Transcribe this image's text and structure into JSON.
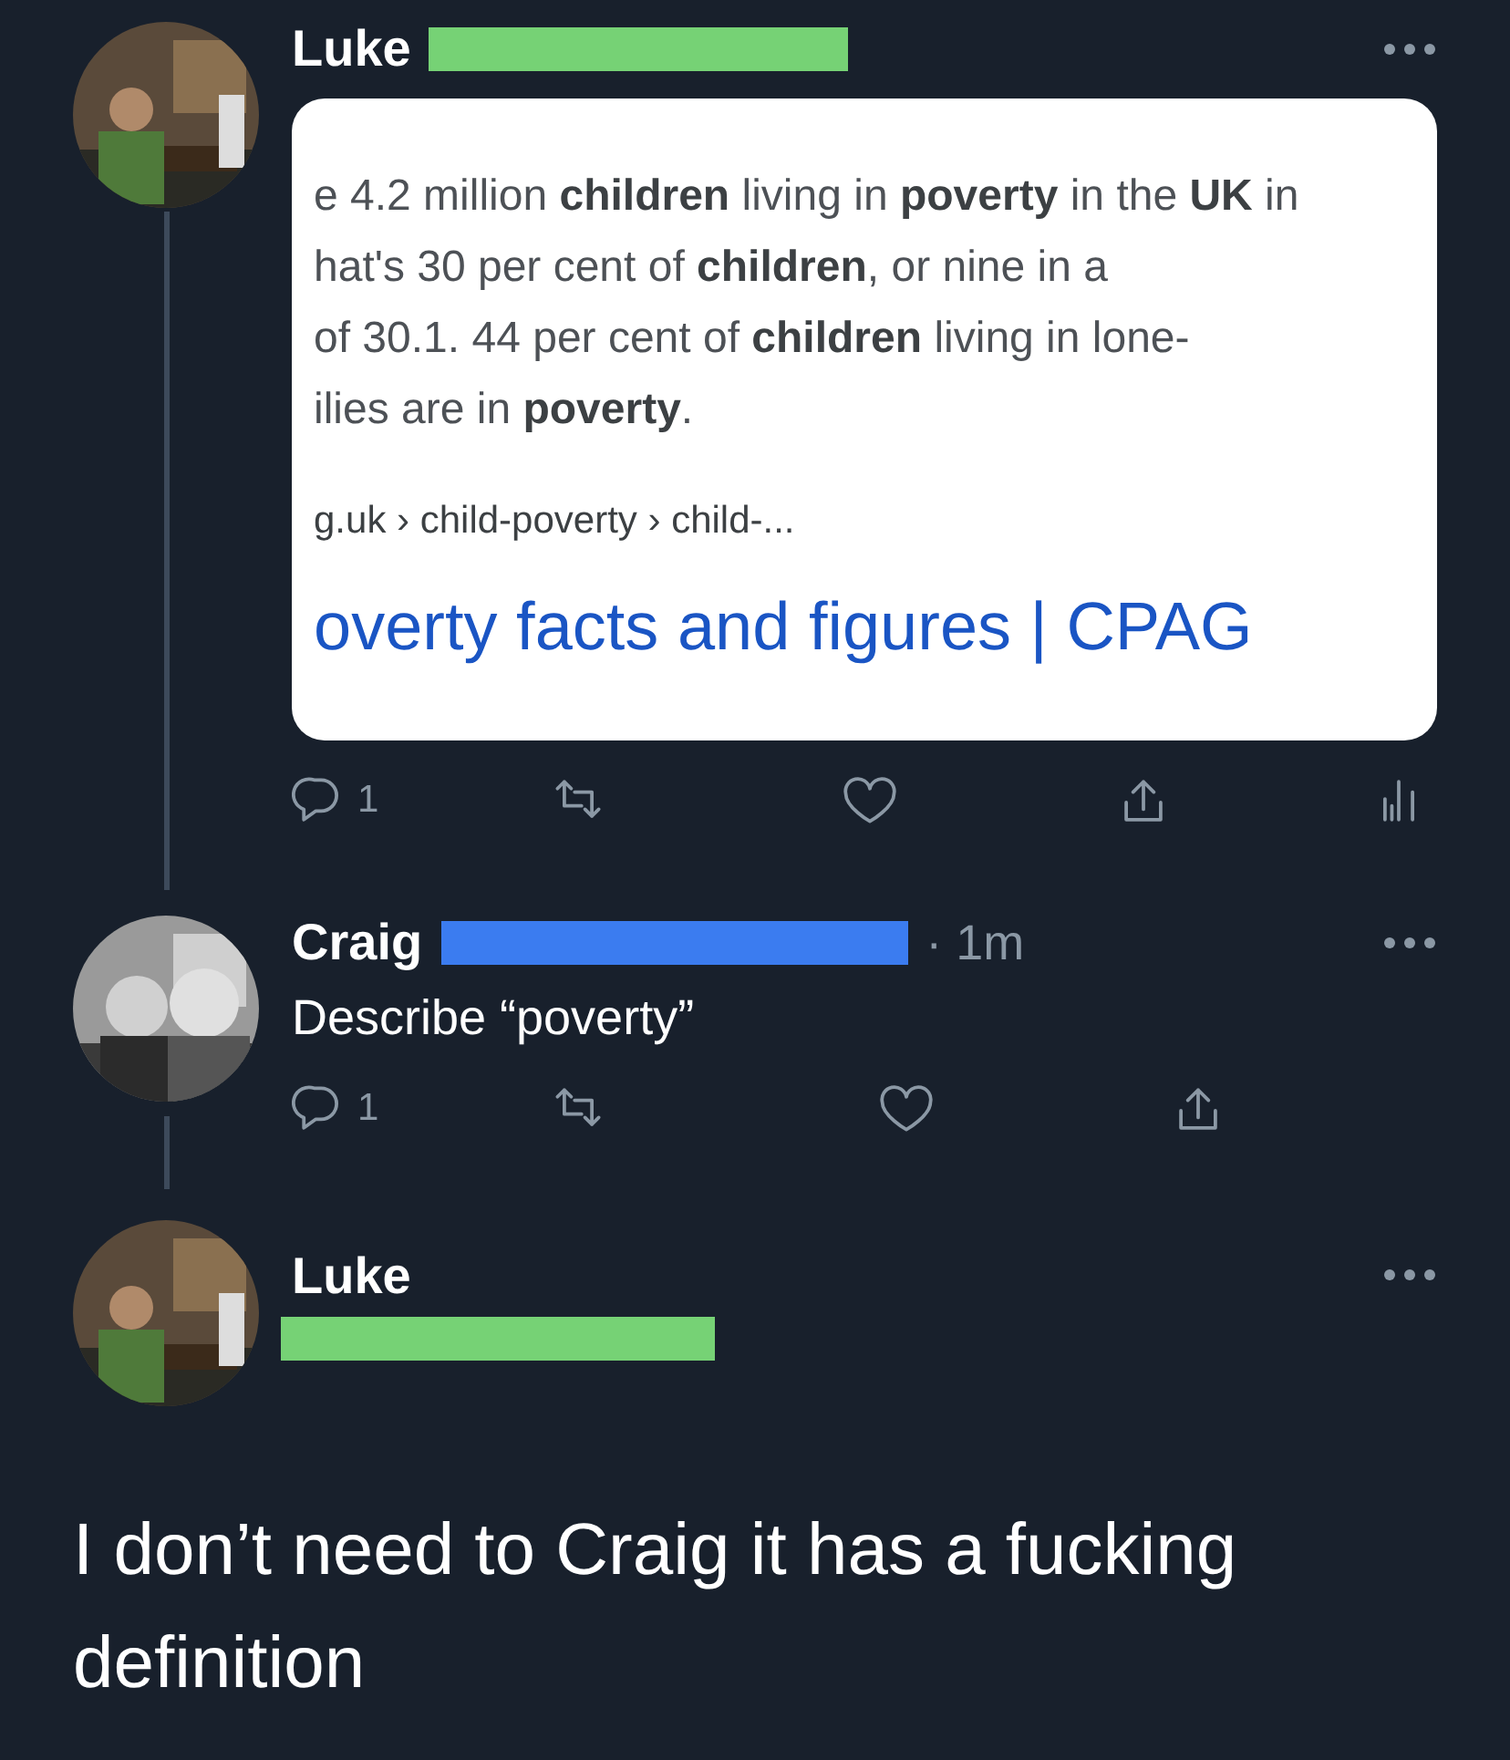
{
  "tweets": [
    {
      "kind": "quote-card",
      "name": "Luke",
      "redaction": {
        "color": "#76d275"
      },
      "card": {
        "lines": [
          "e 4.2 million **children** living in **poverty** in the **UK** in",
          "hat's 30 per cent of **children**, or nine in a",
          "of 30.1. 44 per cent of **children** living in lone-",
          "ilies are in **poverty**."
        ],
        "breadcrumb": "g.uk › child-poverty › child-...",
        "link": "overty facts and figures | CPAG"
      },
      "actions": [
        {
          "kind": "reply",
          "count": "1"
        },
        {
          "kind": "retweet"
        },
        {
          "kind": "like"
        },
        {
          "kind": "share"
        },
        {
          "kind": "analytics"
        }
      ]
    },
    {
      "kind": "text",
      "name": "Craig",
      "redaction": {
        "color": "#3b7cf0"
      },
      "time": "· 1m",
      "text": "Describe “poverty”",
      "actions": [
        {
          "kind": "reply",
          "count": "1"
        },
        {
          "kind": "retweet"
        },
        {
          "kind": "like"
        },
        {
          "kind": "share"
        }
      ]
    },
    {
      "kind": "focus",
      "name": "Luke",
      "redaction": {
        "color": "#76d275"
      },
      "text": "I don’t need to Craig it has a fucking definition"
    }
  ]
}
